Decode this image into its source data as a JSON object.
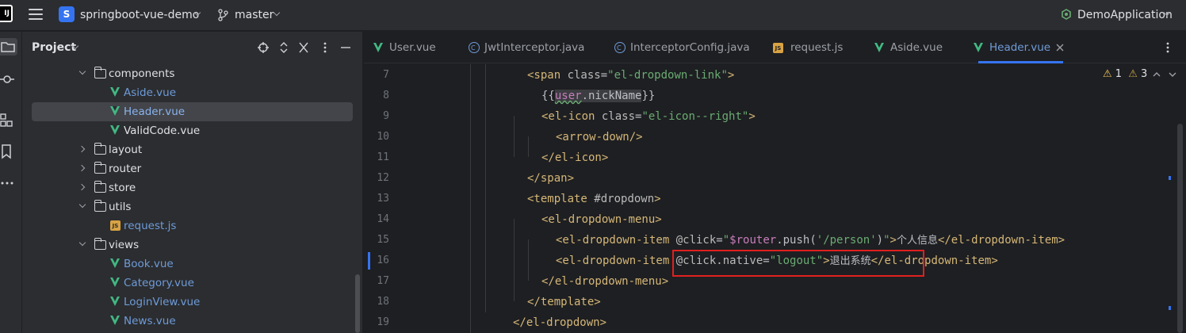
{
  "titlebar": {
    "logo": "IJ",
    "project_badge": "S",
    "project_name": "springboot-vue-demo",
    "branch": "master",
    "run_config": "DemoApplication"
  },
  "project_panel": {
    "title": "Project",
    "tree": [
      {
        "label": "components",
        "kind": "folder",
        "expanded": true
      },
      {
        "label": "Aside.vue",
        "kind": "vue"
      },
      {
        "label": "Header.vue",
        "kind": "vue",
        "selected": true
      },
      {
        "label": "ValidCode.vue",
        "kind": "vue"
      },
      {
        "label": "layout",
        "kind": "folder",
        "expanded": false
      },
      {
        "label": "router",
        "kind": "folder",
        "expanded": false
      },
      {
        "label": "store",
        "kind": "folder",
        "expanded": false
      },
      {
        "label": "utils",
        "kind": "folder",
        "expanded": true
      },
      {
        "label": "request.js",
        "kind": "js"
      },
      {
        "label": "views",
        "kind": "folder",
        "expanded": true
      },
      {
        "label": "Book.vue",
        "kind": "vue"
      },
      {
        "label": "Category.vue",
        "kind": "vue"
      },
      {
        "label": "LoginView.vue",
        "kind": "vue"
      },
      {
        "label": "News.vue",
        "kind": "vue"
      }
    ]
  },
  "editor": {
    "tabs": [
      {
        "label": "User.vue",
        "kind": "vue"
      },
      {
        "label": "JwtInterceptor.java",
        "kind": "class"
      },
      {
        "label": "InterceptorConfig.java",
        "kind": "class"
      },
      {
        "label": "request.js",
        "kind": "js"
      },
      {
        "label": "Aside.vue",
        "kind": "vue"
      },
      {
        "label": "Header.vue",
        "kind": "vue",
        "active": true
      }
    ],
    "inspections": {
      "warnings": "1",
      "weak_warnings": "3"
    },
    "line_numbers": [
      "7",
      "8",
      "9",
      "10",
      "11",
      "12",
      "13",
      "14",
      "15",
      "16",
      "17",
      "18",
      "19"
    ],
    "code": {
      "l7_open": "<span ",
      "l7_attr": "class",
      "l7_eq": "=",
      "l7_str": "\"el-dropdown-link\"",
      "l7_close": ">",
      "l8_open": "{{",
      "l8_user": "user",
      "l8_prop": ".nickName",
      "l8_close": "}}",
      "l9_open": "<el-icon ",
      "l9_attr": "class",
      "l9_eq": "=",
      "l9_str": "\"el-icon--right\"",
      "l9_close": ">",
      "l10": "<arrow-down/>",
      "l11": "</el-icon>",
      "l12": "</span>",
      "l13_open": "<template ",
      "l13_attr": "#dropdown",
      "l13_close": ">",
      "l14": "<el-dropdown-menu>",
      "l15_open": "<el-dropdown-item ",
      "l15_attr": "@click",
      "l15_eq": "=",
      "l15_q1": "\"",
      "l15_code": "$router",
      "l15_push": ".push(",
      "l15_str": "'/person'",
      "l15_paren": ")",
      "l15_q2": "\"",
      "l15_gt": ">",
      "l15_text": "个人信息",
      "l15_close": "</el-dropdown-item>",
      "l16_open": "<el-dropdown-item ",
      "l16_attr": "@click.native",
      "l16_eq": "=",
      "l16_str": "\"logout\"",
      "l16_gt": ">",
      "l16_text": "退出系统",
      "l16_close": "</el-dropdown-item>",
      "l17": "</el-dropdown-menu>",
      "l18": "</template>",
      "l19": "</el-dropdown>"
    }
  },
  "colors": {
    "accent": "#3574f0",
    "vue_green": "#42b883",
    "tag": "#d5b778",
    "string": "#6aab73",
    "annotation_box": "#e02020"
  }
}
